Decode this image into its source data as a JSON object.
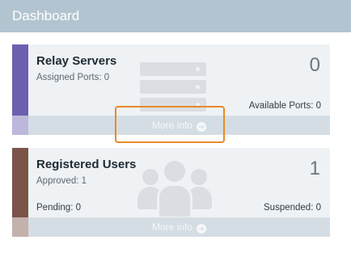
{
  "header": {
    "title": "Dashboard"
  },
  "colors": {
    "header_bg": "#b2c4d0",
    "relay_accent": "#6d5fb0",
    "users_accent": "#7b5348",
    "highlight": "#e8892a"
  },
  "cards": {
    "relay": {
      "title": "Relay Servers",
      "subtitle": "Assigned Ports: 0",
      "count": "0",
      "right_note": "Available Ports: 0",
      "more_info": "More info",
      "icon": "server-icon"
    },
    "users": {
      "title": "Registered Users",
      "subtitle": "Approved: 1",
      "count": "1",
      "left_note": "Pending: 0",
      "right_note": "Suspended: 0",
      "more_info": "More info",
      "icon": "users-icon"
    }
  }
}
